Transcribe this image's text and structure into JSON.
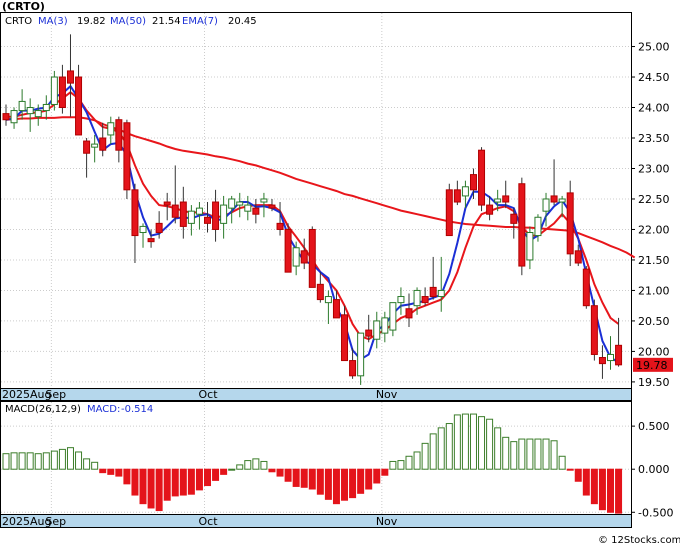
{
  "chart_data": [
    {
      "type": "candlestick",
      "title": "(CRTO)",
      "legend": {
        "symbol": "CRTO",
        "ma3": "MA(3)",
        "ma3_value": "19.82",
        "ma50": "MA(50)",
        "ma50_value": "21.54",
        "ema7": "EMA(7)",
        "ema7_value": "20.45"
      },
      "last_price_label": "19.78",
      "ylim": [
        19.4,
        25.55
      ],
      "yticks": [
        "25.00",
        "24.50",
        "24.00",
        "23.50",
        "23.00",
        "22.50",
        "22.00",
        "21.50",
        "21.00",
        "20.50",
        "20.00",
        "19.50"
      ],
      "date_labels": [
        {
          "label": "2025Aug",
          "index": 0
        },
        {
          "label": "Sep",
          "index": 6
        },
        {
          "label": "Oct",
          "index": 25
        },
        {
          "label": "Nov",
          "index": 47
        }
      ],
      "candles": [
        [
          23.9,
          24.05,
          23.7,
          23.8
        ],
        [
          23.75,
          24.0,
          23.65,
          23.95
        ],
        [
          23.95,
          24.3,
          23.8,
          24.1
        ],
        [
          23.9,
          24.15,
          23.6,
          24.0
        ],
        [
          23.85,
          24.05,
          23.7,
          23.95
        ],
        [
          23.95,
          24.2,
          23.8,
          24.05
        ],
        [
          24.05,
          24.6,
          23.95,
          24.5
        ],
        [
          24.5,
          24.7,
          23.9,
          24.0
        ],
        [
          24.6,
          25.2,
          23.85,
          24.4
        ],
        [
          24.5,
          24.7,
          23.9,
          23.55
        ],
        [
          23.45,
          23.5,
          22.85,
          23.25
        ],
        [
          23.35,
          23.55,
          23.1,
          23.4
        ],
        [
          23.5,
          23.75,
          23.2,
          23.3
        ],
        [
          23.55,
          23.85,
          23.4,
          23.75
        ],
        [
          23.8,
          23.85,
          23.1,
          23.3
        ],
        [
          23.75,
          23.8,
          22.5,
          22.65
        ],
        [
          22.65,
          22.75,
          21.45,
          21.9
        ],
        [
          21.95,
          22.1,
          21.7,
          22.05
        ],
        [
          21.85,
          22.0,
          21.7,
          21.8
        ],
        [
          22.1,
          22.3,
          21.85,
          21.95
        ],
        [
          22.45,
          22.6,
          22.15,
          22.4
        ],
        [
          22.4,
          23.05,
          22.1,
          22.2
        ],
        [
          22.45,
          22.7,
          21.85,
          22.05
        ],
        [
          22.1,
          22.4,
          21.9,
          22.3
        ],
        [
          22.25,
          22.45,
          22.0,
          22.35
        ],
        [
          22.2,
          22.45,
          21.95,
          22.1
        ],
        [
          22.45,
          22.65,
          21.8,
          22.0
        ],
        [
          22.1,
          22.55,
          21.85,
          22.4
        ],
        [
          22.35,
          22.55,
          22.1,
          22.5
        ],
        [
          22.4,
          22.6,
          22.2,
          22.45
        ],
        [
          22.3,
          22.55,
          22.15,
          22.4
        ],
        [
          22.35,
          22.5,
          22.1,
          22.25
        ],
        [
          22.45,
          22.6,
          22.2,
          22.5
        ],
        [
          22.4,
          22.5,
          22.3,
          22.35
        ],
        [
          22.1,
          22.45,
          21.9,
          22.0
        ],
        [
          22.0,
          22.1,
          21.6,
          21.3
        ],
        [
          21.4,
          21.8,
          21.25,
          21.7
        ],
        [
          21.65,
          21.85,
          21.35,
          21.45
        ],
        [
          22.0,
          22.05,
          21.2,
          21.05
        ],
        [
          21.1,
          21.3,
          20.8,
          20.85
        ],
        [
          20.8,
          21.0,
          20.45,
          20.9
        ],
        [
          20.85,
          21.0,
          20.55,
          20.55
        ],
        [
          20.6,
          20.75,
          20.0,
          19.85
        ],
        [
          19.85,
          20.05,
          19.55,
          19.6
        ],
        [
          19.6,
          20.2,
          19.45,
          20.3
        ],
        [
          20.35,
          20.6,
          20.15,
          20.25
        ],
        [
          20.2,
          20.65,
          20.05,
          20.5
        ],
        [
          20.3,
          20.65,
          20.15,
          20.55
        ],
        [
          20.35,
          20.75,
          20.25,
          20.8
        ],
        [
          20.8,
          21.05,
          20.6,
          20.9
        ],
        [
          20.7,
          20.95,
          20.4,
          20.55
        ],
        [
          20.75,
          21.05,
          20.6,
          21.0
        ],
        [
          20.9,
          21.05,
          20.75,
          20.8
        ],
        [
          21.05,
          21.55,
          20.85,
          20.9
        ],
        [
          20.9,
          21.55,
          20.65,
          21.0
        ],
        [
          22.65,
          22.75,
          21.9,
          21.9
        ],
        [
          22.65,
          22.8,
          22.4,
          22.45
        ],
        [
          22.55,
          22.8,
          22.35,
          22.7
        ],
        [
          22.9,
          23.0,
          22.5,
          22.65
        ],
        [
          23.3,
          23.35,
          22.3,
          22.4
        ],
        [
          22.4,
          22.55,
          22.15,
          22.25
        ],
        [
          22.45,
          22.65,
          22.3,
          22.5
        ],
        [
          22.55,
          22.8,
          22.35,
          22.45
        ],
        [
          22.25,
          22.35,
          21.85,
          22.1
        ],
        [
          22.75,
          22.85,
          21.25,
          21.4
        ],
        [
          21.5,
          22.05,
          21.35,
          21.95
        ],
        [
          21.9,
          22.25,
          21.8,
          22.2
        ],
        [
          22.3,
          22.6,
          22.05,
          22.5
        ],
        [
          22.55,
          23.15,
          22.4,
          22.45
        ],
        [
          22.45,
          22.55,
          22.2,
          22.5
        ],
        [
          22.6,
          22.8,
          21.4,
          21.6
        ],
        [
          21.65,
          21.75,
          21.4,
          21.45
        ],
        [
          21.35,
          21.4,
          20.7,
          20.75
        ],
        [
          20.75,
          20.85,
          19.85,
          19.95
        ],
        [
          19.9,
          20.1,
          19.55,
          19.8
        ],
        [
          19.85,
          20.25,
          19.7,
          19.95
        ],
        [
          20.1,
          20.55,
          19.75,
          19.78
        ]
      ],
      "ma50": [
        23.8,
        23.81,
        23.82,
        23.82,
        23.83,
        23.83,
        23.83,
        23.84,
        23.84,
        23.84,
        23.82,
        23.79,
        23.73,
        23.68,
        23.64,
        23.58,
        23.53,
        23.49,
        23.45,
        23.41,
        23.36,
        23.32,
        23.29,
        23.27,
        23.25,
        23.23,
        23.2,
        23.18,
        23.15,
        23.12,
        23.08,
        23.05,
        23.01,
        22.97,
        22.93,
        22.88,
        22.83,
        22.79,
        22.75,
        22.71,
        22.67,
        22.63,
        22.58,
        22.55,
        22.51,
        22.47,
        22.43,
        22.39,
        22.35,
        22.31,
        22.28,
        22.25,
        22.22,
        22.19,
        22.16,
        22.13,
        22.11,
        22.09,
        22.08,
        22.07,
        22.06,
        22.05,
        22.04,
        22.04,
        22.03,
        22.03,
        22.02,
        22.01,
        22.0,
        21.99,
        21.98,
        21.94,
        21.89,
        21.84,
        21.79,
        21.73,
        21.68,
        21.62,
        21.54
      ],
      "ma3": [
        23.8,
        23.82,
        23.95,
        23.95,
        23.98,
        24.0,
        24.17,
        24.23,
        24.35,
        24.15,
        23.92,
        23.6,
        23.3,
        23.4,
        23.42,
        23.22,
        22.62,
        22.2,
        21.9,
        21.93,
        22.05,
        22.18,
        22.2,
        22.18,
        22.23,
        22.25,
        22.15,
        22.17,
        22.3,
        22.45,
        22.45,
        22.37,
        22.38,
        22.35,
        22.28,
        21.9,
        21.67,
        21.48,
        21.43,
        21.3,
        21.2,
        20.73,
        20.47,
        20.02,
        19.87,
        19.95,
        20.35,
        20.43,
        20.62,
        20.75,
        20.77,
        20.8,
        20.83,
        20.88,
        20.93,
        21.27,
        21.78,
        22.35,
        22.62,
        22.62,
        22.53,
        22.4,
        22.4,
        22.35,
        22.0,
        21.82,
        21.9,
        22.22,
        22.38,
        22.48,
        22.28,
        21.85,
        21.27,
        20.72,
        20.17,
        19.9,
        19.82
      ],
      "ema7": [
        23.85,
        23.85,
        23.88,
        23.91,
        23.92,
        23.95,
        24.05,
        24.15,
        24.25,
        24.15,
        23.95,
        23.8,
        23.68,
        23.65,
        23.6,
        23.4,
        23.05,
        22.75,
        22.55,
        22.4,
        22.38,
        22.35,
        22.3,
        22.28,
        22.28,
        22.25,
        22.2,
        22.22,
        22.28,
        22.35,
        22.38,
        22.4,
        22.4,
        22.4,
        22.3,
        22.05,
        21.88,
        21.7,
        21.5,
        21.3,
        21.15,
        21.0,
        20.75,
        20.45,
        20.25,
        20.2,
        20.28,
        20.35,
        20.45,
        20.55,
        20.6,
        20.7,
        20.75,
        20.8,
        20.85,
        21.0,
        21.3,
        21.7,
        22.05,
        22.25,
        22.3,
        22.35,
        22.38,
        22.3,
        22.05,
        21.9,
        21.9,
        22.0,
        22.1,
        22.25,
        22.1,
        21.85,
        21.5,
        21.1,
        20.8,
        20.55,
        20.45
      ],
      "ma50_label": "MA(50)",
      "ma3_label": "MA(3)",
      "ema7_label": "EMA(7)"
    },
    {
      "type": "bar",
      "title": "MACD(26,12,9)",
      "legend": {
        "name": "MACD(26,12,9)",
        "macd_label": "MACD:",
        "macd_value": "-0.514"
      },
      "ylim": [
        -0.52,
        0.78
      ],
      "yticks": [
        "0.500",
        "0.000",
        "-0.500"
      ],
      "date_labels": [
        {
          "label": "2025Aug",
          "index": 0
        },
        {
          "label": "Sep",
          "index": 6
        },
        {
          "label": "Oct",
          "index": 25
        },
        {
          "label": "Nov",
          "index": 47
        }
      ],
      "values": [
        0.18,
        0.19,
        0.19,
        0.19,
        0.18,
        0.19,
        0.21,
        0.23,
        0.25,
        0.2,
        0.12,
        0.08,
        -0.04,
        -0.06,
        -0.08,
        -0.17,
        -0.3,
        -0.4,
        -0.45,
        -0.48,
        -0.36,
        -0.31,
        -0.3,
        -0.29,
        -0.24,
        -0.19,
        -0.13,
        -0.06,
        0.0,
        0.05,
        0.1,
        0.12,
        0.09,
        -0.03,
        -0.08,
        -0.14,
        -0.2,
        -0.21,
        -0.23,
        -0.29,
        -0.35,
        -0.4,
        -0.36,
        -0.33,
        -0.28,
        -0.23,
        -0.16,
        -0.07,
        0.09,
        0.1,
        0.15,
        0.2,
        0.3,
        0.41,
        0.48,
        0.53,
        0.63,
        0.64,
        0.64,
        0.61,
        0.58,
        0.48,
        0.37,
        0.32,
        0.35,
        0.35,
        0.35,
        0.35,
        0.33,
        0.15,
        -0.01,
        -0.14,
        -0.3,
        -0.4,
        -0.47,
        -0.5,
        -0.51
      ]
    }
  ],
  "watermark": "© 12Stocks.com",
  "colors": {
    "up_fill": "#ffffff",
    "up_stroke": "#2b7a2b",
    "down_fill": "#e4141b",
    "down_stroke": "#b00000",
    "ma50": "#e8161b",
    "ma3": "#1b2fd6",
    "ema7": "#e8161b",
    "macd_pos": "#3c7d2a",
    "macd_neg": "#e4141b",
    "axis_bar": "#b5d7ec",
    "grid": "#cccccc",
    "label_box": "#e4141b"
  }
}
